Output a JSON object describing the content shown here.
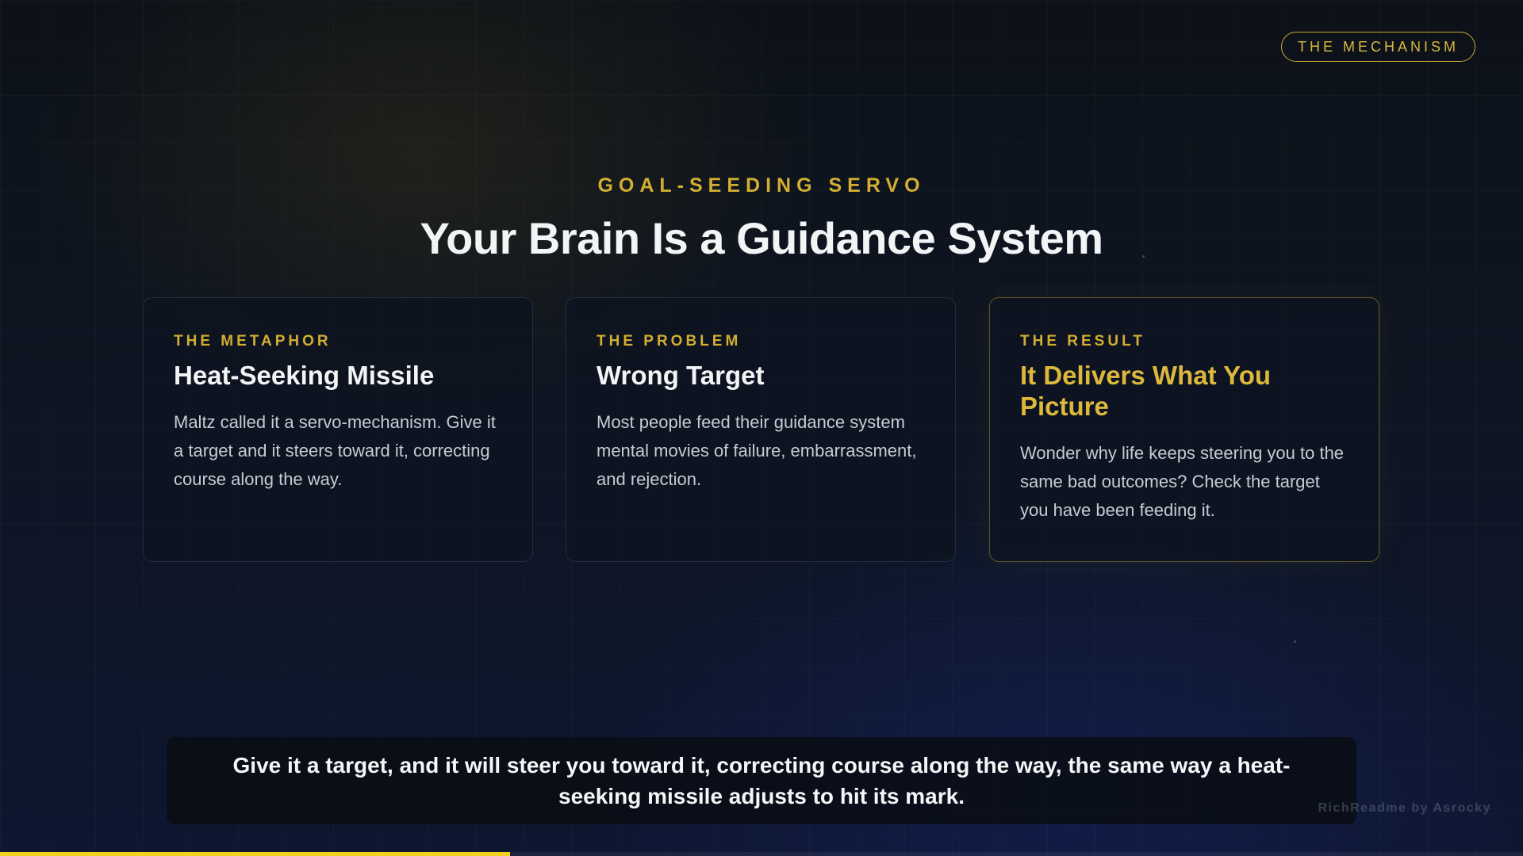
{
  "badge": {
    "label": "THE MECHANISM"
  },
  "header": {
    "eyebrow": "GOAL-SEEDING SERVO",
    "title": "Your Brain Is a Guidance System"
  },
  "cards": [
    {
      "label": "THE METAPHOR",
      "title": "Heat-Seeking Missile",
      "body": "Maltz called it a servo-mechanism. Give it a target and it steers toward it, correcting course along the way."
    },
    {
      "label": "THE PROBLEM",
      "title": "Wrong Target",
      "body": "Most people feed their guidance system mental movies of failure, embarrassment, and rejection."
    },
    {
      "label": "THE RESULT",
      "title": "It Delivers What You Picture",
      "body": "Wonder why life keeps steering you to the same bad outcomes? Check the target you have been feeding it."
    }
  ],
  "caption": {
    "text": "Give it a target, and it will steer you toward it, correcting course along the way, the same way a heat-seeking missile adjusts to hit its mark."
  },
  "watermark": {
    "text": "RichReadme by Asrocky"
  },
  "progress": {
    "fraction": 0.335
  },
  "colors": {
    "accent": "#d2ae33",
    "progress": "#f2d21c",
    "background": "#0e1522"
  }
}
